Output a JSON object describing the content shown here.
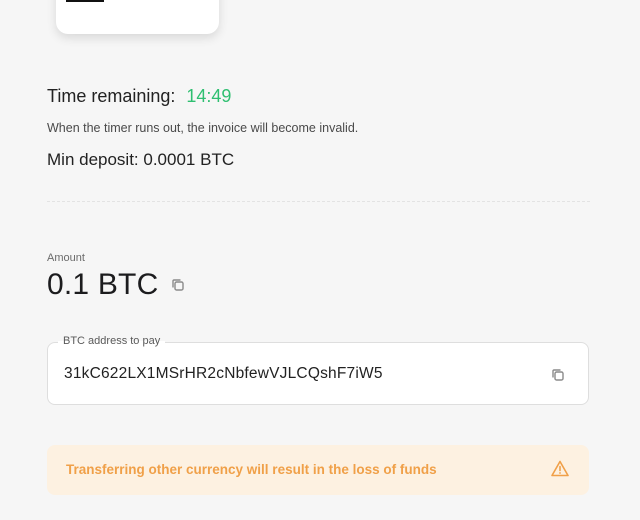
{
  "timer": {
    "label": "Time remaining:",
    "value": "14:49",
    "note": "When the timer runs out, the invoice will become invalid."
  },
  "min_deposit": "Min deposit: 0.0001 BTC",
  "amount": {
    "label": "Amount",
    "value": "0.1 BTC"
  },
  "address": {
    "legend": "BTC address to pay",
    "value": "31kC622LX1MSrHR2cNbfewVJLCQshF7iW5"
  },
  "warning": {
    "text": "Transferring other currency will result in the loss of funds"
  },
  "icons": {
    "copy": "copy-icon",
    "warning": "warning-triangle-icon",
    "qr": "qr-code"
  },
  "colors": {
    "timer": "#2fbf71",
    "warning_text": "#f0a048",
    "warning_bg": "#fdf1e1"
  }
}
